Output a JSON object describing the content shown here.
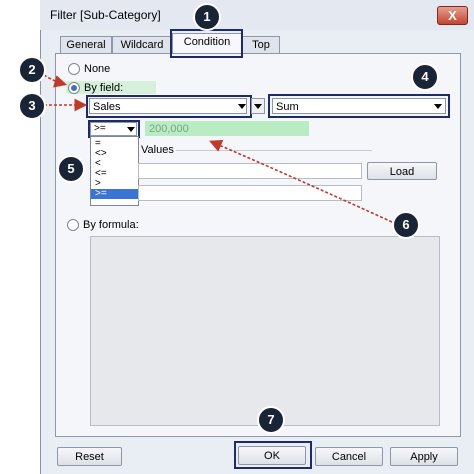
{
  "dialog": {
    "title": "Filter [Sub-Category]",
    "close_label": "X"
  },
  "tabs": [
    {
      "label": "General"
    },
    {
      "label": "Wildcard"
    },
    {
      "label": "Condition"
    },
    {
      "label": "Top"
    }
  ],
  "condition": {
    "none_label": "None",
    "by_field_label": "By field:",
    "field_value": "Sales",
    "aggregation_value": "Sum",
    "operator_value": ">=",
    "value_input": "200,000",
    "operator_options": [
      "=",
      "<>",
      "<",
      "<=",
      ">",
      ">="
    ],
    "range_section_label": "Values",
    "load_label": "Load",
    "by_formula_label": "By formula:"
  },
  "buttons": {
    "reset": "Reset",
    "ok": "OK",
    "cancel": "Cancel",
    "apply": "Apply"
  },
  "annotations": [
    "1",
    "2",
    "3",
    "4",
    "5",
    "6",
    "7"
  ],
  "colors": {
    "callout": "#1a2437",
    "highlight_border": "#1f2a6b",
    "arrow_red": "#c0392b",
    "value_green": "#b9ecc3"
  }
}
